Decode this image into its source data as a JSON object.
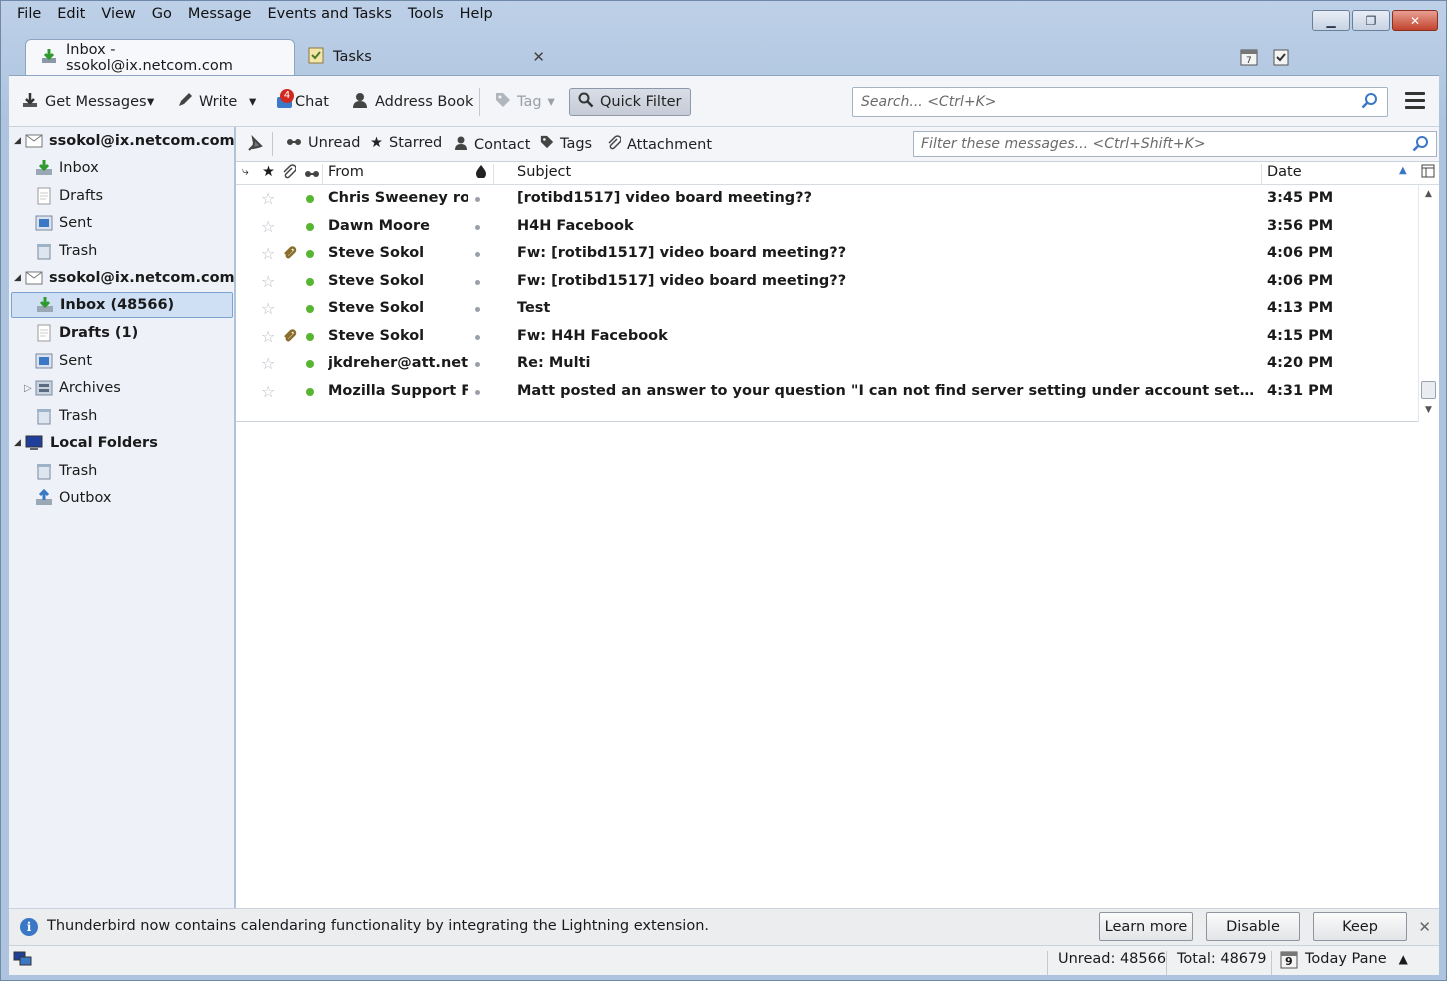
{
  "menu": [
    "File",
    "Edit",
    "View",
    "Go",
    "Message",
    "Events and Tasks",
    "Tools",
    "Help"
  ],
  "tabs": [
    {
      "label": "Inbox - ssokol@ix.netcom.com",
      "active": true
    },
    {
      "label": "Tasks",
      "active": false
    }
  ],
  "toolbar": {
    "get_messages": "Get Messages",
    "write": "Write",
    "chat": "Chat",
    "chat_badge": "4",
    "address_book": "Address Book",
    "tag": "Tag",
    "quick_filter": "Quick Filter",
    "search_placeholder": "Search... <Ctrl+K>"
  },
  "folders": {
    "account1": {
      "name": "ssokol@ix.netcom.com",
      "items": [
        "Inbox",
        "Drafts",
        "Sent",
        "Trash"
      ]
    },
    "account2": {
      "name": "ssokol@ix.netcom.com",
      "inbox": "Inbox (48566)",
      "drafts": "Drafts (1)",
      "sent": "Sent",
      "archives": "Archives",
      "trash": "Trash"
    },
    "local": {
      "name": "Local Folders",
      "trash": "Trash",
      "outbox": "Outbox"
    }
  },
  "quickfilter": {
    "unread": "Unread",
    "starred": "Starred",
    "contact": "Contact",
    "tags": "Tags",
    "attachment": "Attachment",
    "filter_placeholder": "Filter these messages... <Ctrl+Shift+K>"
  },
  "columns": {
    "from": "From",
    "subject": "Subject",
    "date": "Date"
  },
  "messages": [
    {
      "from": "Chris Sweeney rot...",
      "subject": "[rotibd1517] video board meeting??",
      "date": "3:45 PM",
      "attachment": false
    },
    {
      "from": "Dawn Moore",
      "subject": "H4H Facebook",
      "date": "3:56 PM",
      "attachment": false
    },
    {
      "from": "Steve Sokol",
      "subject": "Fw: [rotibd1517] video board meeting??",
      "date": "4:06 PM",
      "attachment": true
    },
    {
      "from": "Steve Sokol",
      "subject": "Fw: [rotibd1517] video board meeting??",
      "date": "4:06 PM",
      "attachment": false
    },
    {
      "from": "Steve Sokol",
      "subject": "Test",
      "date": "4:13 PM",
      "attachment": false
    },
    {
      "from": "Steve Sokol",
      "subject": "Fw: H4H Facebook",
      "date": "4:15 PM",
      "attachment": true
    },
    {
      "from": "jkdreher@att.net",
      "subject": "Re: Multi",
      "date": "4:20 PM",
      "attachment": false
    },
    {
      "from": "Mozilla Support F...",
      "subject": "Matt posted an answer to your question \"I can not find server setting under account settings and need i...",
      "date": "4:31 PM",
      "attachment": false
    }
  ],
  "notification": {
    "message": "Thunderbird now contains calendaring functionality by integrating the Lightning extension.",
    "learn_more": "Learn more",
    "disable": "Disable",
    "keep": "Keep"
  },
  "status": {
    "unread": "Unread: 48566",
    "total": "Total: 48679",
    "today_pane": "Today Pane",
    "calendar_day": "9"
  },
  "colors": {
    "unread_dot": "#58b531",
    "selection": "#cfe0f5",
    "accent": "#3a78c5"
  }
}
